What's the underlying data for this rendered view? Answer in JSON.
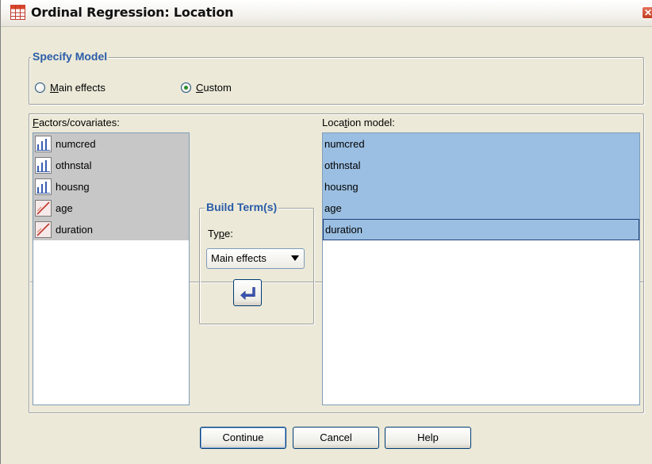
{
  "window": {
    "title": "Ordinal Regression: Location",
    "close_glyph": "✕"
  },
  "specify_model": {
    "legend": "Specify Model",
    "main_effects": {
      "mnemonic": "M",
      "rest": "ain effects",
      "checked": false
    },
    "custom": {
      "mnemonic": "C",
      "rest": "ustom",
      "checked": true
    }
  },
  "factors": {
    "label_mnemonic": "F",
    "label_rest": "actors/covariates:",
    "items": [
      {
        "name": "numcred",
        "icon": "ordinal-icon"
      },
      {
        "name": "othnstal",
        "icon": "ordinal-icon"
      },
      {
        "name": "housng",
        "icon": "ordinal-icon"
      },
      {
        "name": "age",
        "icon": "scale-icon"
      },
      {
        "name": "duration",
        "icon": "scale-icon"
      }
    ]
  },
  "build_terms": {
    "legend": "Build Term(s)",
    "type_label_pre": "Ty",
    "type_label_mnemonic": "p",
    "type_label_post": "e:",
    "type_value": "Main effects",
    "move_icon": "move-right-arrow-icon"
  },
  "location_model": {
    "label_pre": "Loca",
    "label_mnemonic": "t",
    "label_post": "ion model:",
    "items": [
      "numcred",
      "othnstal",
      "housng",
      "age",
      "duration"
    ],
    "focused_index": 4
  },
  "buttons": {
    "continue": "Continue",
    "cancel": "Cancel",
    "help": "Help"
  },
  "colors": {
    "legend": "#2a5ca8",
    "selected_right": "#9bbfe2",
    "selected_left": "#c7c7c7"
  }
}
